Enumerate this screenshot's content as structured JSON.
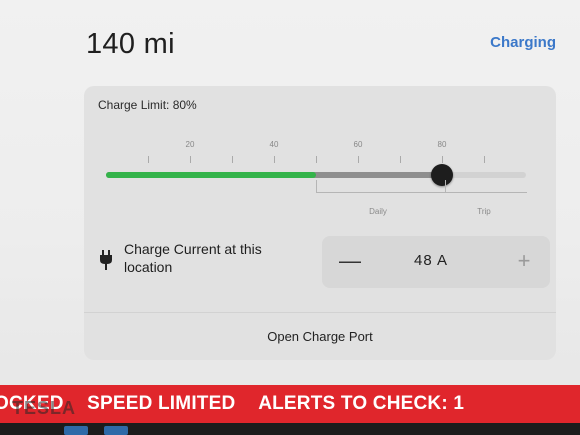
{
  "header": {
    "range": "140 mi",
    "charging_link": "Charging"
  },
  "charge_limit": {
    "label": "Charge Limit: 80%",
    "percent": 80,
    "battery_level_percent": 50,
    "tick_labels": [
      "20",
      "40",
      "60",
      "80"
    ],
    "zone_daily": "Daily",
    "zone_trip": "Trip"
  },
  "charge_current": {
    "label": "Charge Current at this location",
    "value": "48 A",
    "minus": "—",
    "plus": "+"
  },
  "open_port": {
    "label": "Open Charge Port"
  },
  "alerts": {
    "items": [
      "OCKED",
      "SPEED LIMITED",
      "ALERTS TO CHECK: 1"
    ]
  },
  "watermark": "TESLA",
  "colors": {
    "accent": "#3b78c9",
    "battery_green": "#34b34a",
    "alert_red": "#e0262c"
  }
}
